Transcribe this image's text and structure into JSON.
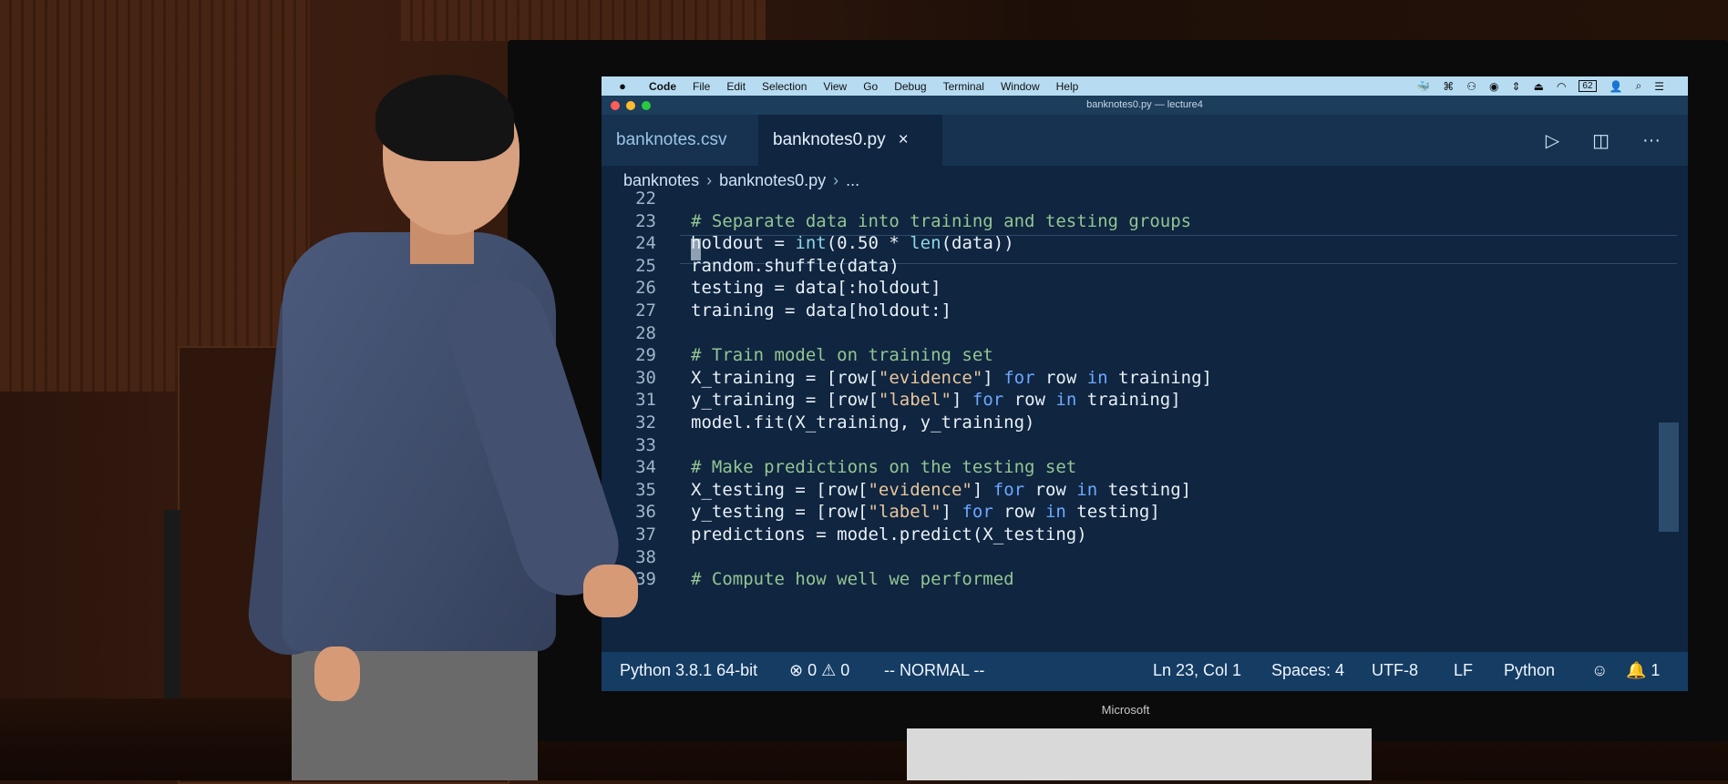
{
  "menubar": {
    "apple": "",
    "items": [
      "Code",
      "File",
      "Edit",
      "Selection",
      "View",
      "Go",
      "Debug",
      "Terminal",
      "Window",
      "Help"
    ],
    "icons": [
      "docker-icon",
      "command-icon",
      "glasses-icon",
      "play-circle-icon",
      "arrows-icon",
      "eject-icon",
      "wifi-icon",
      "battery-icon",
      "user-icon",
      "search-icon",
      "list-icon"
    ],
    "battery": "62"
  },
  "window": {
    "title": "banknotes0.py — lecture4"
  },
  "tabs": [
    {
      "label": "banknotes.csv",
      "active": false
    },
    {
      "label": "banknotes0.py",
      "active": true,
      "close": "×"
    }
  ],
  "tab_actions": {
    "run": "▷",
    "split": "◫",
    "more": "···"
  },
  "breadcrumb": {
    "folder": "banknotes",
    "file": "banknotes0.py",
    "more": "...",
    "sep": "›"
  },
  "editor": {
    "lines": [
      {
        "n": "22",
        "code": ""
      },
      {
        "n": "23",
        "code": "# Separate data into training and testing groups"
      },
      {
        "n": "24",
        "code": "holdout = int(0.50 * len(data))"
      },
      {
        "n": "25",
        "code": "random.shuffle(data)"
      },
      {
        "n": "26",
        "code": "testing = data[:holdout]"
      },
      {
        "n": "27",
        "code": "training = data[holdout:]"
      },
      {
        "n": "28",
        "code": ""
      },
      {
        "n": "29",
        "code": "# Train model on training set"
      },
      {
        "n": "30",
        "code": "X_training = [row[\"evidence\"] for row in training]"
      },
      {
        "n": "31",
        "code": "y_training = [row[\"label\"] for row in training]"
      },
      {
        "n": "32",
        "code": "model.fit(X_training, y_training)"
      },
      {
        "n": "33",
        "code": ""
      },
      {
        "n": "34",
        "code": "# Make predictions on the testing set"
      },
      {
        "n": "35",
        "code": "X_testing = [row[\"evidence\"] for row in testing]"
      },
      {
        "n": "36",
        "code": "y_testing = [row[\"label\"] for row in testing]"
      },
      {
        "n": "37",
        "code": "predictions = model.predict(X_testing)"
      },
      {
        "n": "38",
        "code": ""
      },
      {
        "n": "39",
        "code": "# Compute how well we performed"
      }
    ]
  },
  "statusbar": {
    "python": "Python 3.8.1 64-bit",
    "problems": "⊗ 0 ⚠ 0",
    "mode": "-- NORMAL --",
    "position": "Ln 23, Col 1",
    "spaces": "Spaces: 4",
    "encoding": "UTF-8",
    "eol": "LF",
    "language": "Python",
    "feedback": "☺",
    "notifications": "🔔 1"
  },
  "monitor": {
    "brand": "Microsoft"
  }
}
